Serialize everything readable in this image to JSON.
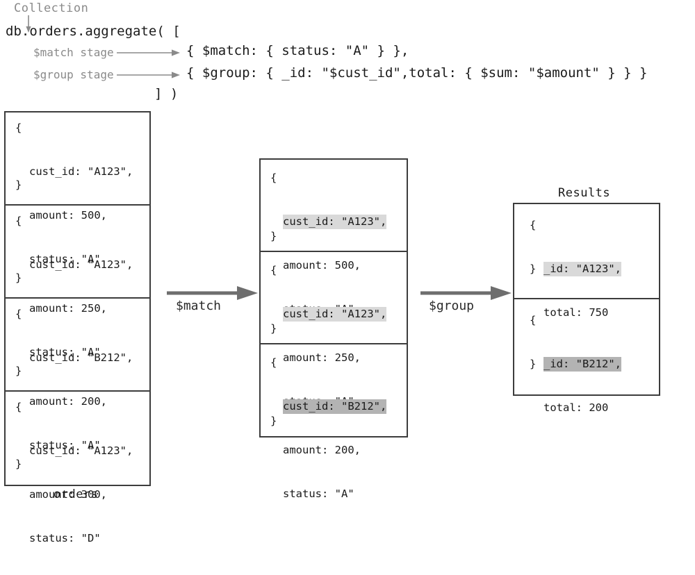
{
  "code": {
    "collection_label": "Collection",
    "line1": "db.orders.aggregate( [",
    "line2": "{ $match: { status: \"A\" } },",
    "line3": "{ $group: { _id: \"$cust_id\",total: { $sum: \"$amount\" } } }",
    "line4": "] )",
    "match_stage_label": "$match stage",
    "group_stage_label": "$group stage"
  },
  "orders": {
    "caption": "orders",
    "open_brace": "{",
    "close_brace": "}",
    "documents": [
      {
        "cust_id": "cust_id: \"A123\",",
        "amount": "amount: 500,",
        "status": "status: \"A\""
      },
      {
        "cust_id": "cust_id: \"A123\",",
        "amount": "amount: 250,",
        "status": "status: \"A\""
      },
      {
        "cust_id": "cust_id: \"B212\",",
        "amount": "amount: 200,",
        "status": "status: \"A\""
      },
      {
        "cust_id": "cust_id: \"A123\",",
        "amount": "amount: 300,",
        "status": "status: \"D\""
      }
    ]
  },
  "match_output": {
    "open_brace": "{",
    "close_brace": "}",
    "documents": [
      {
        "cust_id": "cust_id: \"A123\",",
        "amount": "amount: 500,",
        "status": "status: \"A\"",
        "highlight": "light"
      },
      {
        "cust_id": "cust_id: \"A123\",",
        "amount": "amount: 250,",
        "status": "status: \"A\"",
        "highlight": "light"
      },
      {
        "cust_id": "cust_id: \"B212\",",
        "amount": "amount: 200,",
        "status": "status: \"A\"",
        "highlight": "dark"
      }
    ]
  },
  "results": {
    "title": "Results",
    "open_brace": "{",
    "close_brace": "}",
    "documents": [
      {
        "id": "_id: \"A123\",",
        "total": "total: 750",
        "highlight": "light"
      },
      {
        "id": "_id: \"B212\",",
        "total": "total: 200",
        "highlight": "dark"
      }
    ]
  },
  "stages": {
    "match_arrow_label": "$match",
    "group_arrow_label": "$group"
  },
  "colors": {
    "border": "#3c3c3c",
    "text": "#1a1a1a",
    "annotation": "#8a8a8a",
    "highlight_light": "#d9d9d9",
    "highlight_dark": "#b3b3b3",
    "arrow": "#6e6e6e",
    "background": "#ffffff"
  }
}
